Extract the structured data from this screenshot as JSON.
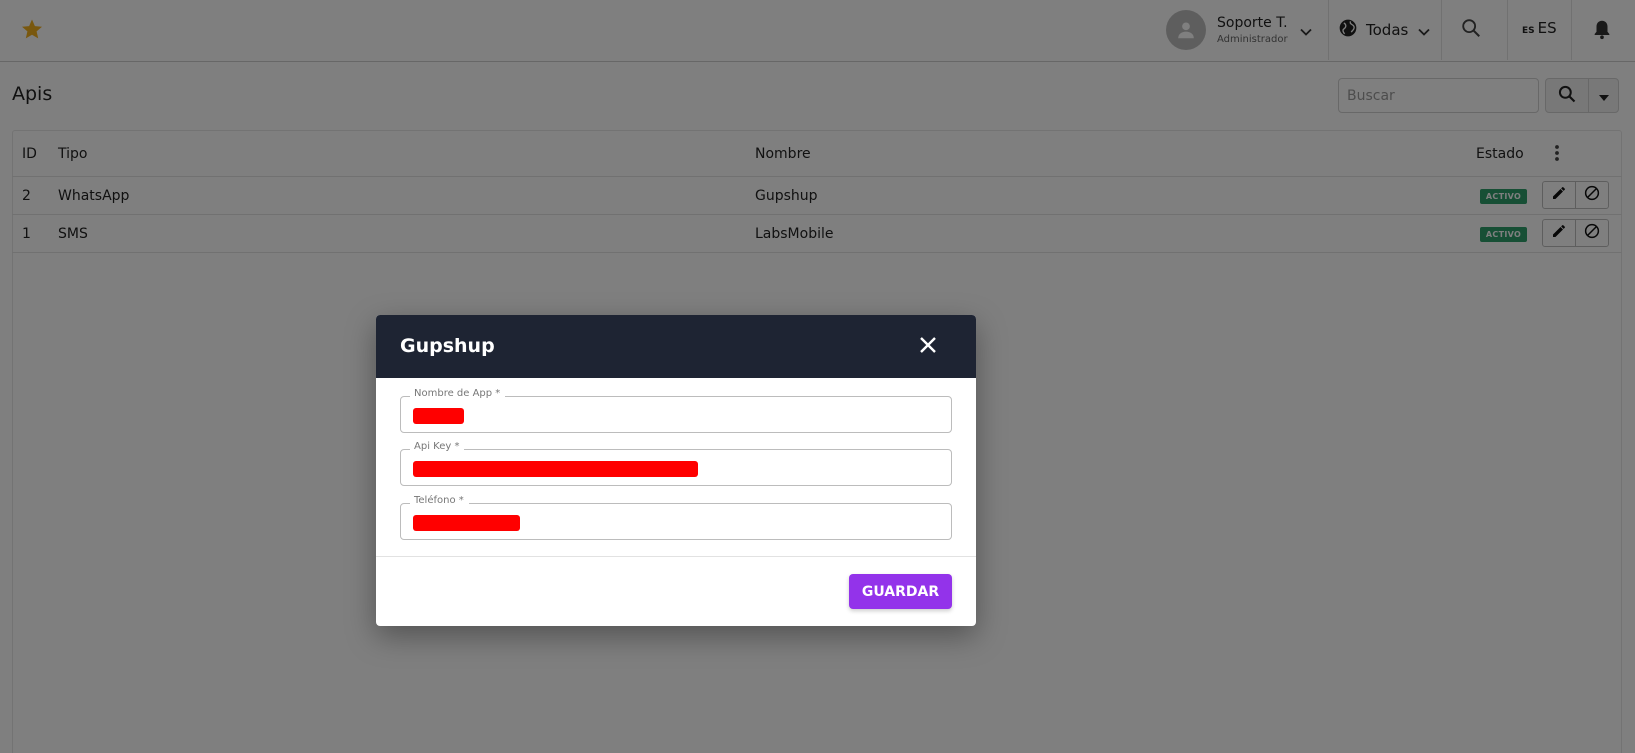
{
  "header": {
    "user": {
      "name": "Soporte T.",
      "role": "Administrador"
    },
    "region": {
      "label": "Todas"
    },
    "language": {
      "code": "ES",
      "label": "ES"
    }
  },
  "page": {
    "title": "Apis",
    "search": {
      "placeholder": "Buscar"
    }
  },
  "table": {
    "columns": {
      "id": "ID",
      "type": "Tipo",
      "name": "Nombre",
      "status": "Estado"
    },
    "rows": [
      {
        "id": "2",
        "type": "WhatsApp",
        "name": "Gupshup",
        "status": "ACTIVO"
      },
      {
        "id": "1",
        "type": "SMS",
        "name": "LabsMobile",
        "status": "ACTIVO"
      }
    ]
  },
  "modal": {
    "title": "Gupshup",
    "fields": [
      {
        "label": "Nombre de App *",
        "value_redacted": true
      },
      {
        "label": "Api Key *",
        "value_redacted": true
      },
      {
        "label": "Teléfono *",
        "value_redacted": true
      }
    ],
    "save_label": "GUARDAR"
  },
  "colors": {
    "accent": "#9333ea",
    "modal_header": "#1e2433",
    "active_badge": "#2e9e6b",
    "star": "#f2b01e",
    "redaction": "#ff0000"
  },
  "icons": [
    "star-icon",
    "user-avatar-icon",
    "chevron-down-icon",
    "globe-icon",
    "search-icon",
    "bell-icon",
    "more-vertical-icon",
    "edit-icon",
    "block-icon",
    "close-icon",
    "caret-down-icon"
  ]
}
